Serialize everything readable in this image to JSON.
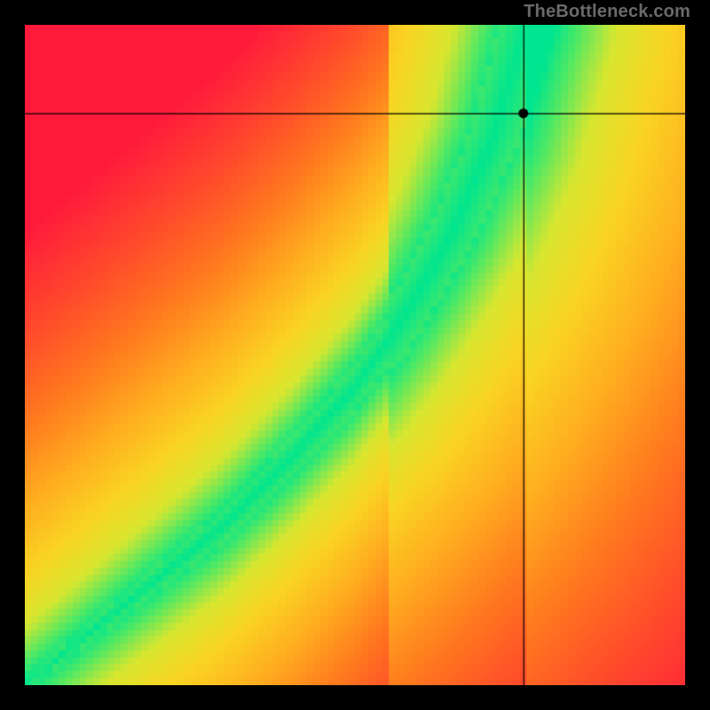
{
  "attribution": "TheBottleneck.com",
  "chart_data": {
    "type": "heatmap",
    "title": "",
    "xlabel": "",
    "ylabel": "",
    "xlim": [
      0,
      1
    ],
    "ylim": [
      0,
      1
    ],
    "crosshair": {
      "x": 0.755,
      "y": 0.866
    },
    "marker": {
      "x": 0.755,
      "y": 0.866
    },
    "optimal_curve": [
      {
        "x": 0.0,
        "y": 0.0
      },
      {
        "x": 0.1,
        "y": 0.08
      },
      {
        "x": 0.2,
        "y": 0.16
      },
      {
        "x": 0.3,
        "y": 0.24
      },
      {
        "x": 0.4,
        "y": 0.34
      },
      {
        "x": 0.5,
        "y": 0.45
      },
      {
        "x": 0.55,
        "y": 0.52
      },
      {
        "x": 0.6,
        "y": 0.6
      },
      {
        "x": 0.65,
        "y": 0.69
      },
      {
        "x": 0.68,
        "y": 0.76
      },
      {
        "x": 0.71,
        "y": 0.83
      },
      {
        "x": 0.73,
        "y": 0.9
      },
      {
        "x": 0.75,
        "y": 0.97
      },
      {
        "x": 0.76,
        "y": 1.0
      }
    ],
    "curve_half_width": [
      {
        "x": 0.0,
        "w": 0.01
      },
      {
        "x": 0.2,
        "w": 0.02
      },
      {
        "x": 0.4,
        "w": 0.03
      },
      {
        "x": 0.6,
        "w": 0.038
      },
      {
        "x": 0.76,
        "w": 0.045
      }
    ],
    "gradient_stops": [
      {
        "t": 0.0,
        "color": "#00e58f"
      },
      {
        "t": 0.08,
        "color": "#4fe864"
      },
      {
        "t": 0.18,
        "color": "#d8e62f"
      },
      {
        "t": 0.3,
        "color": "#f9d423"
      },
      {
        "t": 0.45,
        "color": "#ffae1f"
      },
      {
        "t": 0.62,
        "color": "#ff7a1e"
      },
      {
        "t": 0.8,
        "color": "#ff4a2b"
      },
      {
        "t": 1.0,
        "color": "#ff1a3c"
      }
    ],
    "pixelation": 96
  }
}
